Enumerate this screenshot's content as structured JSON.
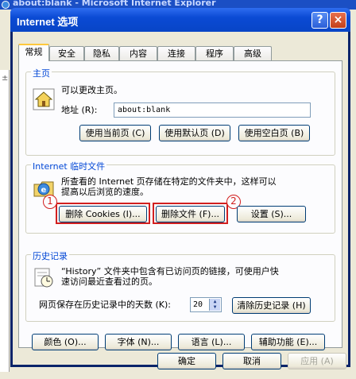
{
  "background": {
    "title": "about:blank - Microsoft Internet Explorer",
    "left_strip_mark": "±"
  },
  "dialog": {
    "title": "Internet 选项",
    "help_label": "?",
    "close_label": "×"
  },
  "tabs": [
    {
      "label": "常规",
      "active": true
    },
    {
      "label": "安全"
    },
    {
      "label": "隐私"
    },
    {
      "label": "内容"
    },
    {
      "label": "连接"
    },
    {
      "label": "程序"
    },
    {
      "label": "高级"
    }
  ],
  "homepage": {
    "group_title": "主页",
    "desc": "可以更改主页。",
    "address_label": "地址 (R):",
    "address_value": "about:blank",
    "buttons": {
      "use_current": "使用当前页 (C)",
      "use_default": "使用默认页 (D)",
      "use_blank": "使用空白页 (B)"
    },
    "icon": "house-icon"
  },
  "temp_files": {
    "group_title": "Internet 临时文件",
    "desc_line1": "所查看的 Internet 页存储在特定的文件夹中，这样可以",
    "desc_line2": "提高以后浏览的速度。",
    "buttons": {
      "delete_cookies": "删除 Cookies (I)...",
      "delete_files": "删除文件 (F)...",
      "settings": "设置 (S)..."
    },
    "badges": {
      "one": "1",
      "two": "2"
    },
    "highlight_color": "#d21f1f",
    "icon": "ie-folder-icon"
  },
  "history": {
    "group_title": "历史记录",
    "desc_line1": "“History” 文件夹中包含有已访问页的链接，可使用户快",
    "desc_line2": "速访问最近查看过的页。",
    "days_label": "网页保存在历史记录中的天数 (K):",
    "days_value": "20",
    "clear_button": "清除历史记录 (H)",
    "icon": "history-clock-icon"
  },
  "bottom_buttons": {
    "colors": "颜色 (O)...",
    "fonts": "字体 (N)...",
    "languages": "语言 (L)...",
    "accessibility": "辅助功能 (E)..."
  },
  "footer": {
    "ok": "确定",
    "cancel": "取消",
    "apply": "应用 (A)"
  },
  "colors": {
    "title_blue": "#0a4ad4",
    "group_title": "#0046d5",
    "face": "#ece9d8",
    "panel": "#fcfcfe"
  }
}
